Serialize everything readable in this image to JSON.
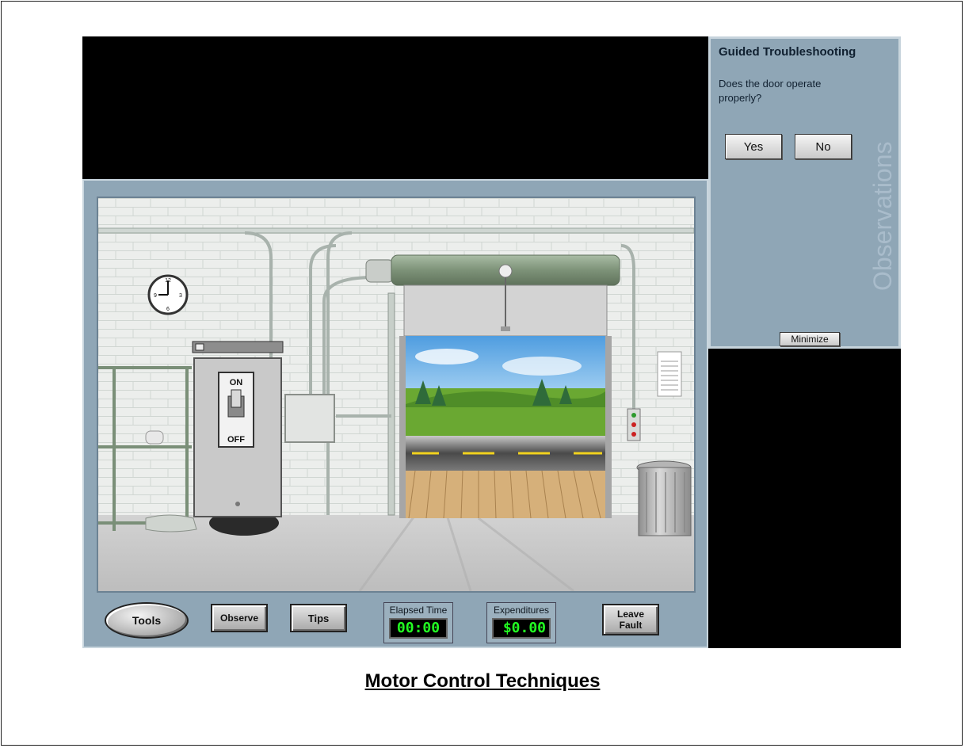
{
  "panel": {
    "title": "Guided Troubleshooting",
    "question": "Does the door operate properly?",
    "yes_label": "Yes",
    "no_label": "No",
    "watermark": "Observations",
    "minimize_label": "Minimize"
  },
  "toolbar": {
    "tools_label": "Tools",
    "observe_label": "Observe",
    "tips_label": "Tips",
    "elapsed_label": "Elapsed Time",
    "elapsed_value": "00:00",
    "expend_label": "Expenditures",
    "expend_value": "$0.00",
    "leave_label": "Leave Fault"
  },
  "switch": {
    "on_label": "ON",
    "off_label": "OFF"
  },
  "caption": "Motor Control Techniques",
  "colors": {
    "frame": "#8fa6b6",
    "readout_text": "#22ff22",
    "sky": "#6fb0e6",
    "grass": "#6aa832"
  }
}
